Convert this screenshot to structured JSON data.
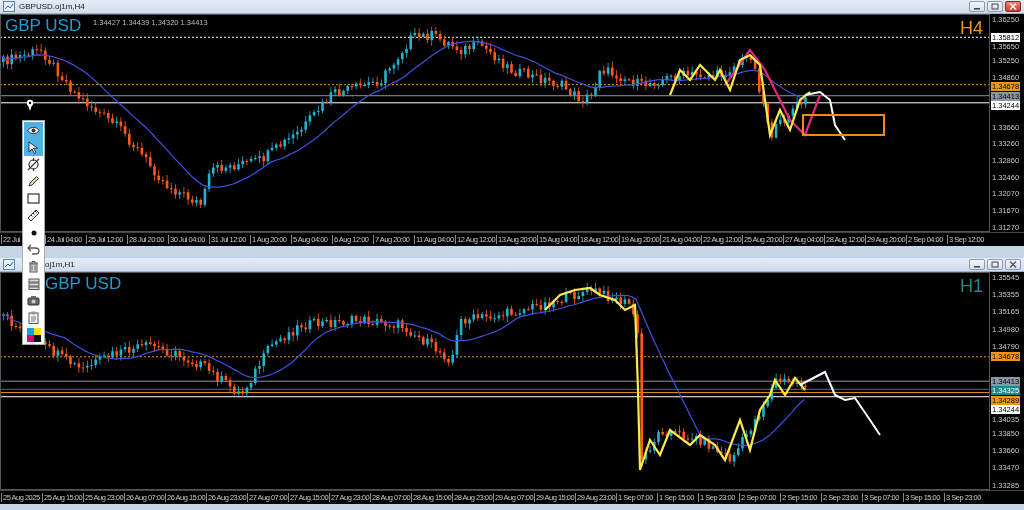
{
  "windows": [
    {
      "title": "GBPUSD.oj1m,H4",
      "active": true,
      "symbol": "GBP USD",
      "quote": "1.34427 1.34439 1.34320 1.34413",
      "timeframe": "H4",
      "price_ticks": [
        "1.36250",
        "1.35650",
        "1.35250",
        "1.34860",
        "1.33660",
        "1.33260",
        "1.32860",
        "1.32460",
        "1.32070",
        "1.31670",
        "1.31270"
      ],
      "price_tags": [
        {
          "text": "1.35812",
          "color": "#ffffff",
          "kind": "dotted"
        },
        {
          "text": "1.34678",
          "color": "#f0960f",
          "kind": "dotted"
        },
        {
          "text": "1.34413",
          "color": "#8a97a6",
          "kind": "solid"
        },
        {
          "text": "1.34244",
          "color": "#ffffff",
          "kind": "solid"
        }
      ],
      "time_ticks": [
        "22 Jul",
        "24 Jul 04:00",
        "25 Jul 12:00",
        "28 Jul 20:00",
        "30 Jul 04:00",
        "31 Jul 12:00",
        "1 Aug 20:00",
        "5 Aug 04:00",
        "6 Aug 12:00",
        "7 Aug 20:00",
        "11 Aug 04:00",
        "12 Aug 12:00",
        "13 Aug 20:00",
        "15 Aug 04:00",
        "18 Aug 12:00",
        "19 Aug 20:00",
        "21 Aug 04:00",
        "22 Aug 12:00",
        "25 Aug 20:00",
        "27 Aug 04:00",
        "28 Aug 12:00",
        "29 Aug 20:00",
        "2 Sep 04:00",
        "3 Sep 12:00"
      ]
    },
    {
      "title": "oj1m,H1",
      "active": false,
      "symbol": "GBP USD",
      "timeframe": "H1",
      "price_ticks": [
        "1.35545",
        "1.35355",
        "1.35165",
        "1.34980",
        "1.34790",
        "1.34035",
        "1.33850",
        "1.33660",
        "1.33470",
        "1.33285"
      ],
      "price_tags": [
        {
          "text": "1.34678",
          "color": "#f0960f",
          "kind": "dotted"
        },
        {
          "text": "1.34413",
          "color": "#8a97a6",
          "kind": "solid"
        },
        {
          "text": "1.34325",
          "color": "#138c8c",
          "kind": "solid"
        },
        {
          "text": "1.34289",
          "color": "#f0960f",
          "kind": "solid"
        },
        {
          "text": "1.34244",
          "color": "#ffffff",
          "kind": "solid"
        }
      ],
      "time_ticks": [
        "25 Aug 2025",
        "25 Aug 15:00",
        "25 Aug 23:00",
        "26 Aug 07:00",
        "26 Aug 15:00",
        "26 Aug 23:00",
        "27 Aug 07:00",
        "27 Aug 15:00",
        "27 Aug 23:00",
        "28 Aug 07:00",
        "28 Aug 15:00",
        "28 Aug 23:00",
        "29 Aug 07:00",
        "29 Aug 15:00",
        "29 Aug 23:00",
        "1 Sep 07:00",
        "1 Sep 15:00",
        "1 Sep 23:00",
        "2 Sep 07:00",
        "2 Sep 15:00",
        "2 Sep 23:00",
        "3 Sep 07:00",
        "3 Sep 15:00",
        "3 Sep 23:00"
      ]
    }
  ],
  "tools": [
    {
      "kind": "eye",
      "selected": true
    },
    {
      "kind": "cursor",
      "selected": true
    },
    {
      "kind": "crosshair",
      "selected": false
    },
    {
      "kind": "pencil",
      "selected": false
    },
    {
      "kind": "rectangle",
      "selected": false
    },
    {
      "kind": "ruler",
      "selected": false
    },
    {
      "kind": "dot",
      "selected": false
    },
    {
      "kind": "undo",
      "selected": false
    },
    {
      "kind": "trash",
      "selected": false
    },
    {
      "kind": "layers",
      "selected": false
    },
    {
      "kind": "camera",
      "selected": false
    },
    {
      "kind": "clipboard",
      "selected": false
    },
    {
      "kind": "palette",
      "selected": false
    }
  ]
}
